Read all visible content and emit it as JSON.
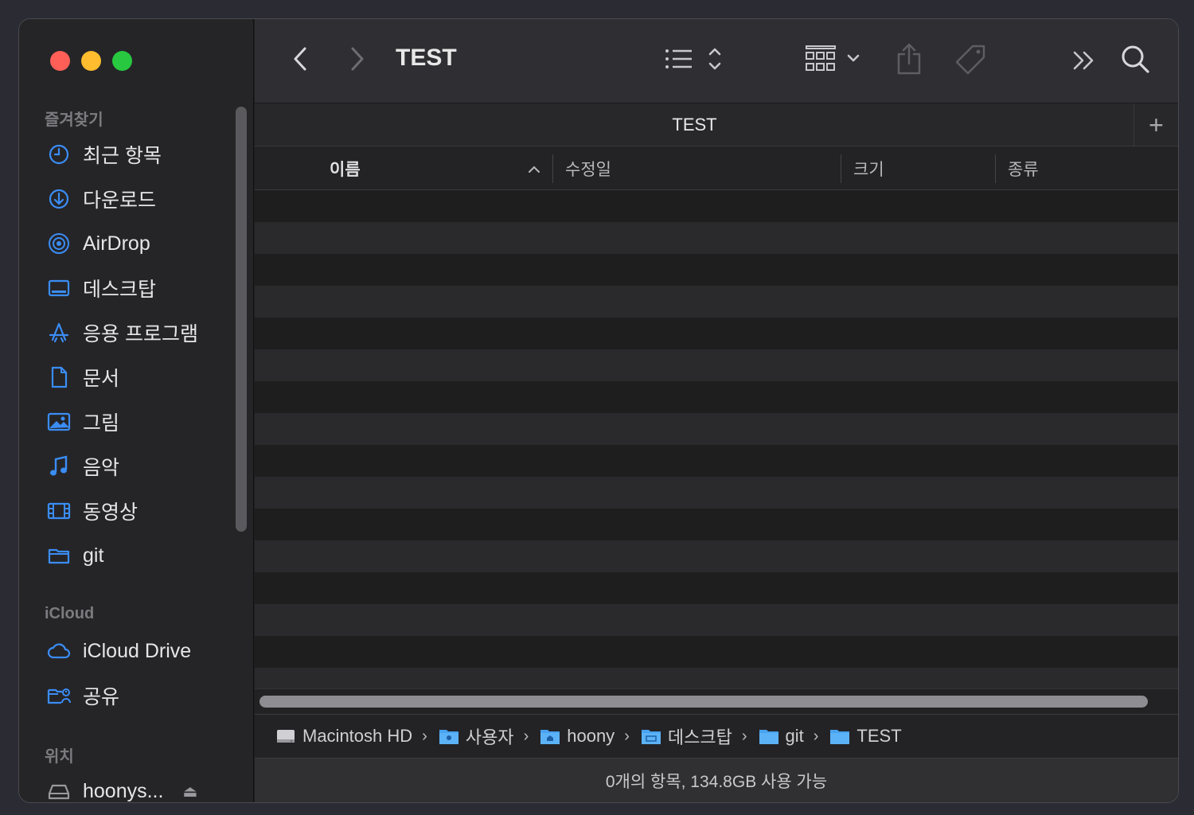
{
  "window": {
    "title": "TEST"
  },
  "sidebar": {
    "favorites_label": "즐겨찾기",
    "favorites": [
      {
        "label": "최근 항목",
        "icon": "clock-icon"
      },
      {
        "label": "다운로드",
        "icon": "download-icon"
      },
      {
        "label": "AirDrop",
        "icon": "airdrop-icon"
      },
      {
        "label": "데스크탑",
        "icon": "desktop-icon"
      },
      {
        "label": "응용 프로그램",
        "icon": "applications-icon"
      },
      {
        "label": "문서",
        "icon": "document-icon"
      },
      {
        "label": "그림",
        "icon": "picture-icon"
      },
      {
        "label": "음악",
        "icon": "music-icon"
      },
      {
        "label": "동영상",
        "icon": "movie-icon"
      },
      {
        "label": "git",
        "icon": "folder-icon"
      }
    ],
    "icloud_label": "iCloud",
    "icloud": [
      {
        "label": "iCloud Drive",
        "icon": "cloud-icon"
      },
      {
        "label": "공유",
        "icon": "shared-folder-icon"
      }
    ],
    "locations_label": "위치",
    "locations": [
      {
        "label": "hoonys...",
        "icon": "disk-icon"
      }
    ]
  },
  "tab": {
    "label": "TEST"
  },
  "columns": {
    "name": "이름",
    "modified": "수정일",
    "size": "크기",
    "kind": "종류"
  },
  "pathbar": [
    {
      "label": "Macintosh HD",
      "icon": "hard-disk-icon"
    },
    {
      "label": "사용자",
      "icon": "users-folder-icon"
    },
    {
      "label": "hoony",
      "icon": "home-folder-icon"
    },
    {
      "label": "데스크탑",
      "icon": "desktop-folder-icon"
    },
    {
      "label": "git",
      "icon": "folder-icon"
    },
    {
      "label": "TEST",
      "icon": "folder-icon"
    }
  ],
  "status": "0개의 항목, 134.8GB 사용 가능",
  "colors": {
    "accent": "#3b8df5",
    "folder": "#4aa3f0"
  }
}
